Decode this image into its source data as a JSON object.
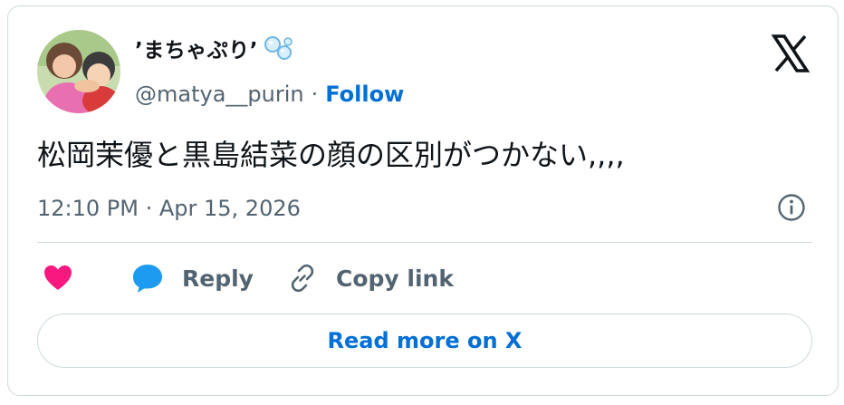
{
  "tweet": {
    "author": {
      "display_name": "’まちゃぷり’",
      "name_emoji": "bubbles-emoji",
      "handle": "@matya__purin",
      "separator": "·",
      "follow_label": "Follow"
    },
    "text": "松岡茉優と黒島結菜の顔の区別がつかない,,,,",
    "timestamp": "12:10 PM · Apr 15, 2026",
    "actions": {
      "like_icon": "heart-icon",
      "reply_icon": "speech-bubble-icon",
      "reply_label": "Reply",
      "copy_icon": "link-icon",
      "copy_label": "Copy link"
    },
    "read_more_label": "Read more on X",
    "brand_icon": "x-logo-icon",
    "info_icon": "info-icon"
  },
  "colors": {
    "text_primary": "#0f1419",
    "text_secondary": "#536471",
    "link_blue": "#006fd6",
    "heart_pink": "#f91880",
    "reply_blue": "#1d9bf0",
    "border": "#cfd9de"
  }
}
